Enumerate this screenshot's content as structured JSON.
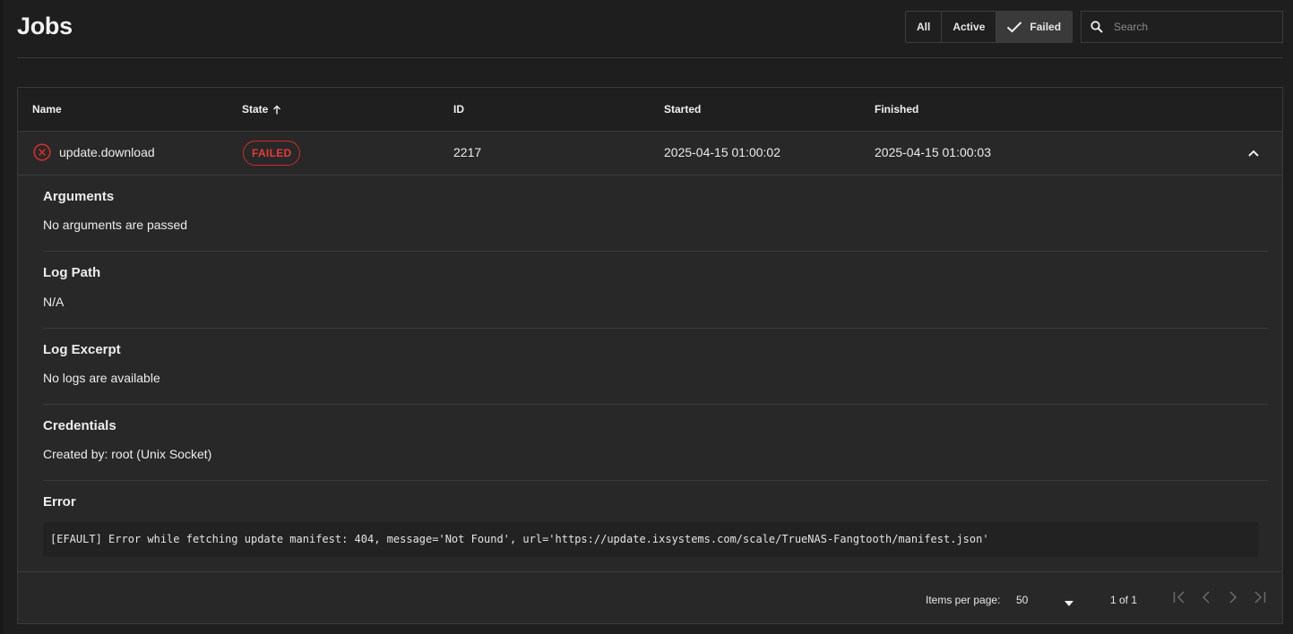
{
  "page": {
    "title": "Jobs"
  },
  "filters": {
    "all_label": "All",
    "active_label": "Active",
    "failed_label": "Failed",
    "selected": "Failed"
  },
  "search": {
    "placeholder": "Search"
  },
  "table": {
    "columns": {
      "name": "Name",
      "state": "State",
      "id": "ID",
      "started": "Started",
      "finished": "Finished"
    },
    "sort": {
      "column": "State",
      "direction": "ascending"
    },
    "rows": [
      {
        "name": "update.download",
        "state": "FAILED",
        "id": "2217",
        "started": "2025-04-15 01:00:02",
        "finished": "2025-04-15 01:00:03",
        "expanded": true
      }
    ]
  },
  "details": {
    "arguments_title": "Arguments",
    "arguments_value": "No arguments are passed",
    "log_path_title": "Log Path",
    "log_path_value": "N/A",
    "log_excerpt_title": "Log Excerpt",
    "log_excerpt_value": "No logs are available",
    "credentials_title": "Credentials",
    "credentials_value": "Created by: root (Unix Socket)",
    "error_title": "Error",
    "error_value": "[EFAULT] Error while fetching update manifest: 404, message='Not Found', url='https://update.ixsystems.com/scale/TrueNAS-Fangtooth/manifest.json'"
  },
  "pagination": {
    "items_per_page_label": "Items per page:",
    "items_per_page_value": "50",
    "range_label": "1 of 1"
  },
  "colors": {
    "background": "#1e1e1e",
    "card": "#282828",
    "failed_red": "#d12c2c"
  },
  "icons": {
    "search": "search-icon",
    "check": "check-icon",
    "sort": "arrow-up-icon",
    "status": "error-circle-icon",
    "collapse": "chevron-up-icon",
    "dropdown": "caret-down-icon",
    "first": "first-page-icon",
    "prev": "chevron-left-icon",
    "next": "chevron-right-icon",
    "last": "last-page-icon"
  }
}
